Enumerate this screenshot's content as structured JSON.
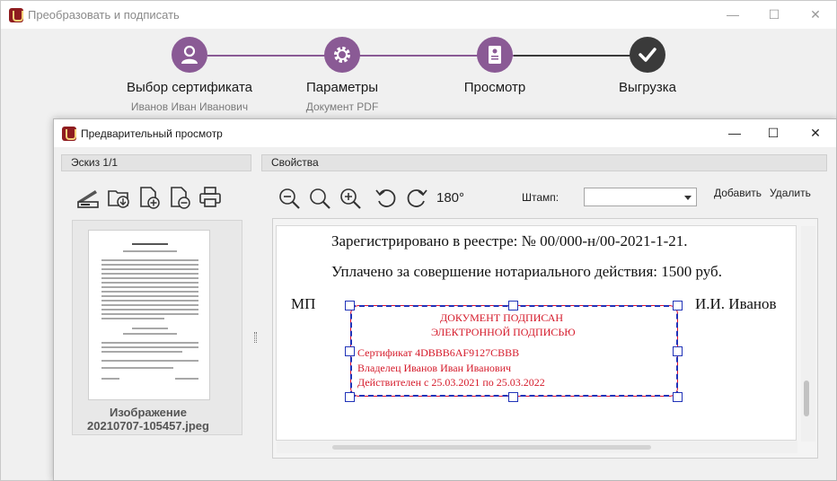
{
  "main_window": {
    "title": "Преобразовать и подписать",
    "controls": {
      "minimize": "—",
      "maximize": "☐",
      "close": "✕"
    }
  },
  "wizard": {
    "steps": [
      {
        "label": "Выбор сертификата",
        "sub": "Иванов Иван Иванович",
        "icon": "user-icon"
      },
      {
        "label": "Параметры",
        "sub": "Документ PDF",
        "icon": "gear-icon"
      },
      {
        "label": "Просмотр",
        "sub": "",
        "icon": "certificate-icon"
      },
      {
        "label": "Выгрузка",
        "sub": "",
        "icon": "checkmark-icon"
      }
    ],
    "colors": {
      "active": "#8a5a95",
      "final": "#3a3a3a",
      "line_active": "#8a5a95",
      "line_final": "#3a3a3a"
    }
  },
  "dialog": {
    "title": "Предварительный просмотр",
    "controls": {
      "minimize": "—",
      "maximize": "☐",
      "close": "✕"
    },
    "sketch": {
      "header": "Эскиз 1/1",
      "toolbar_icons": [
        "scanner-icon",
        "folder-download-icon",
        "add-page-icon",
        "remove-page-icon",
        "print-icon"
      ],
      "thumbnail": {
        "name_line1": "Изображение",
        "name_line2": "20210707-105457.jpeg"
      }
    },
    "properties": {
      "header": "Свойства",
      "toolbar_icons": [
        "zoom-out-icon",
        "zoom-fit-icon",
        "zoom-in-icon",
        "rotate-left-icon",
        "rotate-right-icon",
        "rotate-180-icon"
      ],
      "rotate_180_label": "180°",
      "stamp_label": "Штамп:",
      "stamp_value": "",
      "add_label": "Добавить",
      "remove_label": "Удалить"
    },
    "preview": {
      "line1": "Зарегистрировано в реестре: № 00/000-н/00-2021-1-21.",
      "line2": "Уплачено за совершение нотариального действия: 1500 руб.",
      "left_mark": "МП",
      "right_mark": "И.И. Иванов",
      "stamp": {
        "title1": "ДОКУМЕНТ ПОДПИСАН",
        "title2": "ЭЛЕКТРОННОЙ ПОДПИСЬЮ",
        "cert": "Сертификат 4DBBB6AF9127CBBB",
        "owner": "Владелец  Иванов Иван Иванович",
        "valid": "Действителен с 25.03.2021 по 25.03.2022",
        "colors": {
          "text": "#d51a2a",
          "frame": "#e01030",
          "selection": "#2033b8"
        }
      }
    }
  }
}
